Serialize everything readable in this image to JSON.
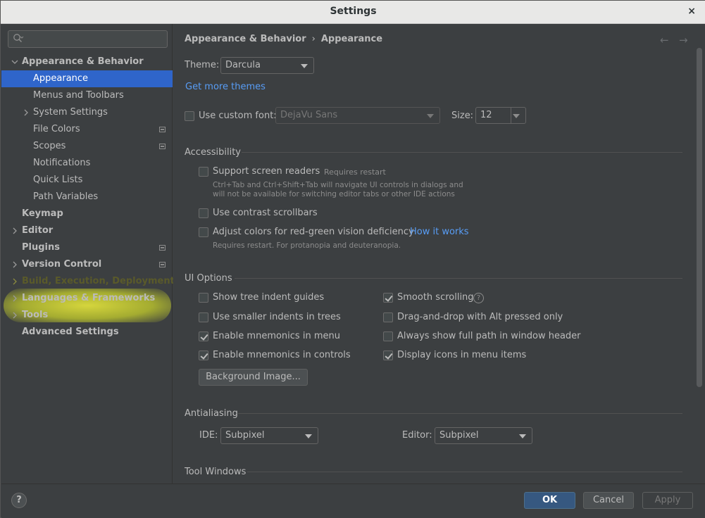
{
  "window": {
    "title": "Settings",
    "close_glyph": "×"
  },
  "search": {
    "placeholder": "",
    "icon": "search-icon"
  },
  "sidebar": {
    "items": [
      {
        "label": "Appearance & Behavior",
        "expanded": true
      },
      {
        "label": "Appearance",
        "selected": true
      },
      {
        "label": "Menus and Toolbars"
      },
      {
        "label": "System Settings"
      },
      {
        "label": "File Colors"
      },
      {
        "label": "Scopes"
      },
      {
        "label": "Notifications"
      },
      {
        "label": "Quick Lists"
      },
      {
        "label": "Path Variables"
      },
      {
        "label": "Keymap"
      },
      {
        "label": "Editor"
      },
      {
        "label": "Plugins"
      },
      {
        "label": "Version Control"
      },
      {
        "label": "Build, Execution, Deployment",
        "highlighted": true
      },
      {
        "label": "Languages & Frameworks"
      },
      {
        "label": "Tools"
      },
      {
        "label": "Advanced Settings"
      }
    ]
  },
  "breadcrumb": {
    "parent": "Appearance & Behavior",
    "separator": "›",
    "current": "Appearance",
    "back": "←",
    "forward": "→"
  },
  "theme": {
    "label": "Theme:",
    "value": "Darcula",
    "more_link": "Get more themes"
  },
  "font": {
    "checkbox_label": "Use custom font:",
    "checked": false,
    "family": "DejaVu Sans",
    "size_label": "Size:",
    "size": "12"
  },
  "accessibility": {
    "title": "Accessibility",
    "screen_readers": {
      "label": "Support screen readers",
      "checked": false,
      "note": "Requires restart",
      "hint_1": "Ctrl+Tab and Ctrl+Shift+Tab will navigate UI controls in dialogs and",
      "hint_2": "will not be available for switching editor tabs or other IDE actions"
    },
    "contrast_scrollbars": {
      "label": "Use contrast scrollbars",
      "checked": false
    },
    "color_deficiency": {
      "label": "Adjust colors for red-green vision deficiency",
      "checked": false,
      "link": "How it works",
      "hint": "Requires restart. For protanopia and deuteranopia."
    }
  },
  "ui_options": {
    "title": "UI Options",
    "left": [
      {
        "label": "Show tree indent guides",
        "checked": false
      },
      {
        "label": "Use smaller indents in trees",
        "checked": false
      },
      {
        "label": "Enable mnemonics in menu",
        "checked": true
      },
      {
        "label": "Enable mnemonics in controls",
        "checked": true
      }
    ],
    "right": [
      {
        "label": "Smooth scrolling",
        "checked": true
      },
      {
        "label": "Drag-and-drop with Alt pressed only",
        "checked": false
      },
      {
        "label": "Always show full path in window header",
        "checked": false
      },
      {
        "label": "Display icons in menu items",
        "checked": true
      }
    ],
    "background_button": "Background Image...",
    "help_glyph": "?"
  },
  "antialiasing": {
    "title": "Antialiasing",
    "ide_label": "IDE:",
    "ide_value": "Subpixel",
    "editor_label": "Editor:",
    "editor_value": "Subpixel"
  },
  "tool_windows": {
    "title": "Tool Windows"
  },
  "footer": {
    "help": "?",
    "ok": "OK",
    "cancel": "Cancel",
    "apply": "Apply"
  },
  "colors": {
    "background": "#3c3f41",
    "selection": "#2f65ca",
    "link": "#589df6",
    "highlight": "#e6e63c",
    "primary_button": "#365880"
  }
}
